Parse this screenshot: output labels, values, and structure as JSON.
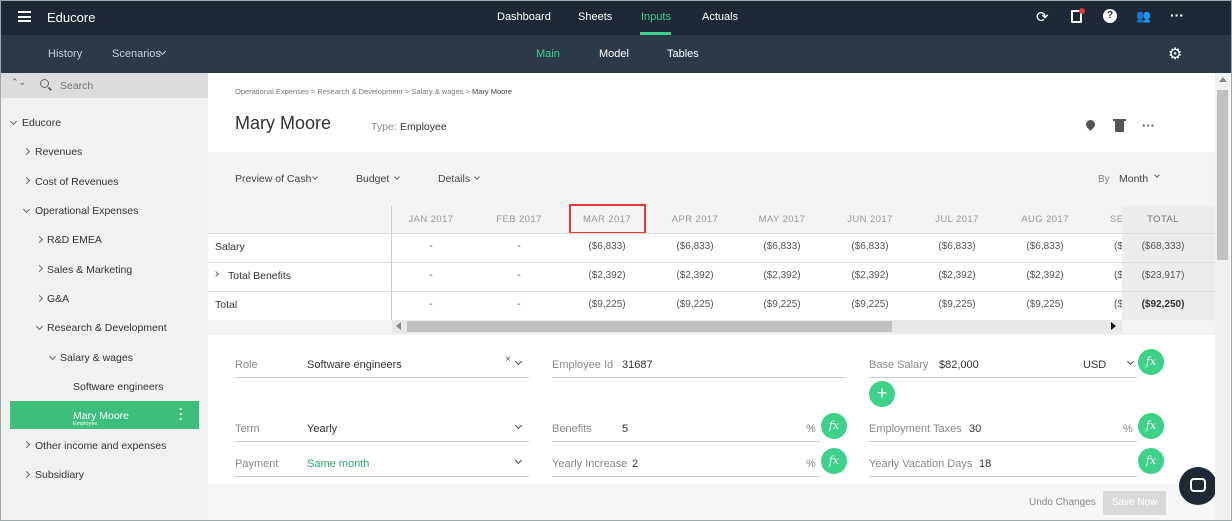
{
  "app": {
    "name": "Educore"
  },
  "topnav": {
    "items": [
      "Dashboard",
      "Sheets",
      "Inputs",
      "Actuals"
    ],
    "active": "Inputs"
  },
  "subnav": {
    "left": [
      "History",
      "Scenarios"
    ],
    "tabs": [
      "Main",
      "Model",
      "Tables"
    ],
    "active_tab": "Main"
  },
  "sidebar": {
    "search_placeholder": "Search",
    "root": "Educore",
    "items": [
      {
        "label": "Revenues"
      },
      {
        "label": "Cost of Revenues"
      },
      {
        "label": "Operational Expenses"
      },
      {
        "label": "R&D EMEA"
      },
      {
        "label": "Sales & Marketing"
      },
      {
        "label": "G&A"
      },
      {
        "label": "Research & Development"
      },
      {
        "label": "Salary & wages"
      },
      {
        "label": "Software engineers"
      },
      {
        "label": "Mary Moore",
        "sub": "Employee"
      },
      {
        "label": "Other income and expenses"
      },
      {
        "label": "Subsidiary"
      }
    ]
  },
  "breadcrumb": {
    "path": "Operational Expenses > Research & Development > Salary & wages > ",
    "current": "Mary Moore"
  },
  "page": {
    "title": "Mary Moore",
    "type_label": "Type:",
    "type_value": "Employee"
  },
  "toolbar": {
    "preview": "Preview of Cash",
    "budget": "Budget",
    "details": "Details",
    "by_label": "By",
    "by_value": "Month"
  },
  "grid": {
    "columns": [
      "JAN 2017",
      "FEB 2017",
      "MAR 2017",
      "APR 2017",
      "MAY 2017",
      "JUN 2017",
      "JUL 2017",
      "AUG 2017",
      "SE"
    ],
    "total_header": "TOTAL",
    "rows": [
      {
        "label": "Salary",
        "values": [
          "-",
          "-",
          "($6,833)",
          "($6,833)",
          "($6,833)",
          "($6,833)",
          "($6,833)",
          "($6,833)",
          "($"
        ],
        "total": "($68,333)"
      },
      {
        "label": "Total Benefits",
        "values": [
          "-",
          "-",
          "($2,392)",
          "($2,392)",
          "($2,392)",
          "($2,392)",
          "($2,392)",
          "($2,392)",
          "($"
        ],
        "total": "($23,917)"
      },
      {
        "label": "Total",
        "values": [
          "-",
          "-",
          "($9,225)",
          "($9,225)",
          "($9,225)",
          "($9,225)",
          "($9,225)",
          "($9,225)",
          "($"
        ],
        "total": "($92,250)"
      }
    ]
  },
  "form": {
    "role_label": "Role",
    "role_value": "Software engineers",
    "employee_id_label": "Employee Id",
    "employee_id_value": "31687",
    "base_salary_label": "Base Salary",
    "base_salary_value": "$82,000",
    "currency": "USD",
    "term_label": "Term",
    "term_value": "Yearly",
    "benefits_label": "Benefits",
    "benefits_value": "5",
    "employment_taxes_label": "Employment Taxes",
    "employment_taxes_value": "30",
    "payment_label": "Payment",
    "payment_value": "Same month",
    "yearly_increase_label": "Yearly Increase",
    "yearly_increase_value": "2",
    "vacation_label": "Yearly Vacation Days",
    "vacation_value": "18",
    "percent": "%",
    "fx": "fx",
    "clear": "×"
  },
  "footer": {
    "undo": "Undo Changes",
    "save": "Save Now"
  },
  "colors": {
    "accent": "#3dd189",
    "topbar": "#1e2935",
    "subbar": "#2c3a48",
    "highlight": "#e0393e"
  }
}
